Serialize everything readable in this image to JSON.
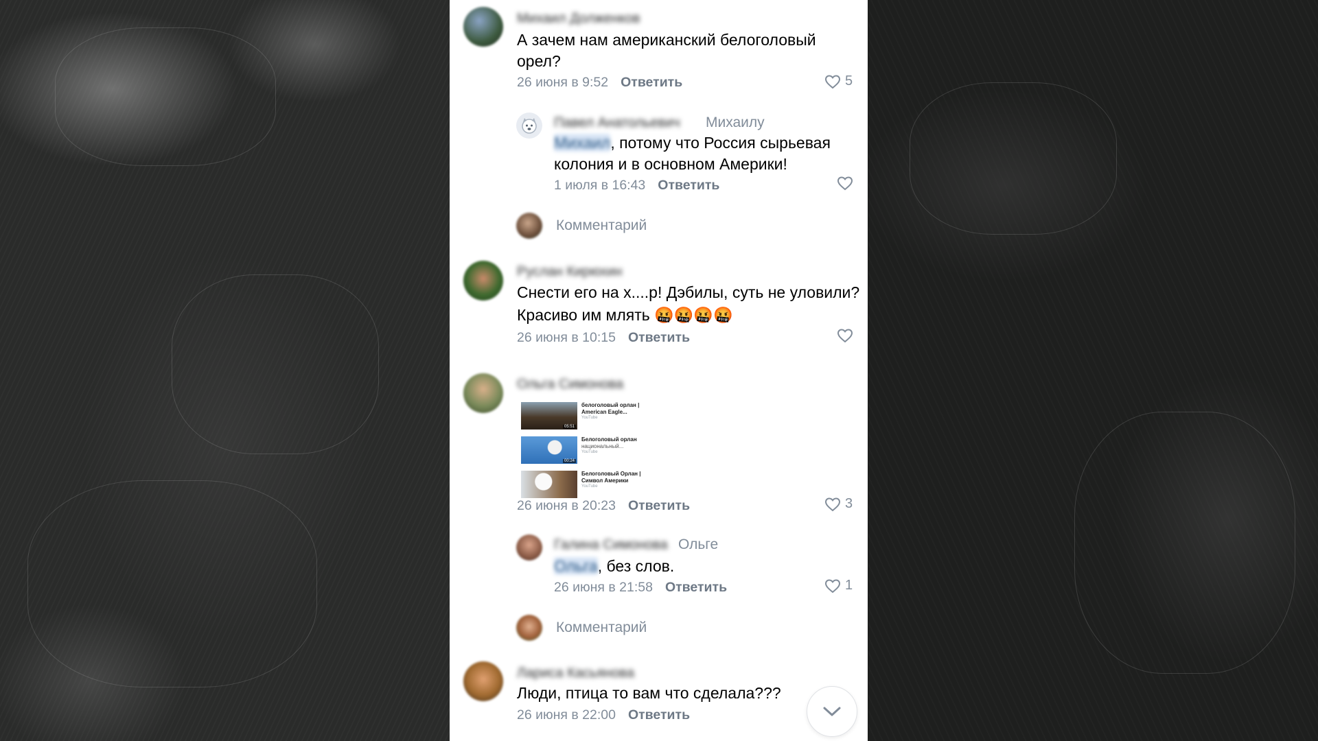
{
  "comments": [
    {
      "author": "Михаил Долженков",
      "text": "А зачем нам американский белоголовый орел?",
      "time": "26 июня в 9:52",
      "reply_label": "Ответить",
      "likes": "5"
    },
    {
      "author": "Павел Анатольевич",
      "reply_to": "Михаилу",
      "mention": "Михаил",
      "text": ", потому что Россия сырьевая колония и в основном Америки!",
      "time": "1 июля в 16:43",
      "reply_label": "Ответить"
    },
    {
      "author": "Руслан Кирюхин",
      "text": "Снести его на х....р!  Дэбилы, суть не уловили? Красиво им млять",
      "emojis": [
        "🤬",
        "🤬",
        "🤬",
        "🤬"
      ],
      "time": "26 июня в 10:15",
      "reply_label": "Ответить"
    },
    {
      "author": "Ольга Симонова",
      "attachments": [
        {
          "title": "белоголовый орлан | American Eagle...",
          "source": "YouTube",
          "duration": "05:51"
        },
        {
          "title": "Белоголовый орлан",
          "subtitle": "национальный...",
          "source": "YouTube",
          "duration": "00:24"
        },
        {
          "title": "Белоголовый Орлан | Символ Америки",
          "source": "YouTube"
        }
      ],
      "time": "26 июня в 20:23",
      "reply_label": "Ответить",
      "likes": "3"
    },
    {
      "author": "Галина Симонова",
      "reply_to": "Ольге",
      "mention": "Ольга",
      "text": ", без слов.",
      "time": "26 июня в 21:58",
      "reply_label": "Ответить",
      "likes": "1"
    },
    {
      "author": "Лариса Касьянова",
      "text": "Люди, птица то вам что сделала???",
      "time": "26 июня в 22:00",
      "reply_label": "Ответить"
    }
  ],
  "write_comment_label": "Комментарий",
  "icons": {
    "like": "heart-icon",
    "scroll": "chevron-down-icon"
  },
  "colors": {
    "secondary_text": "#818c99",
    "accent": "#2a5885"
  }
}
